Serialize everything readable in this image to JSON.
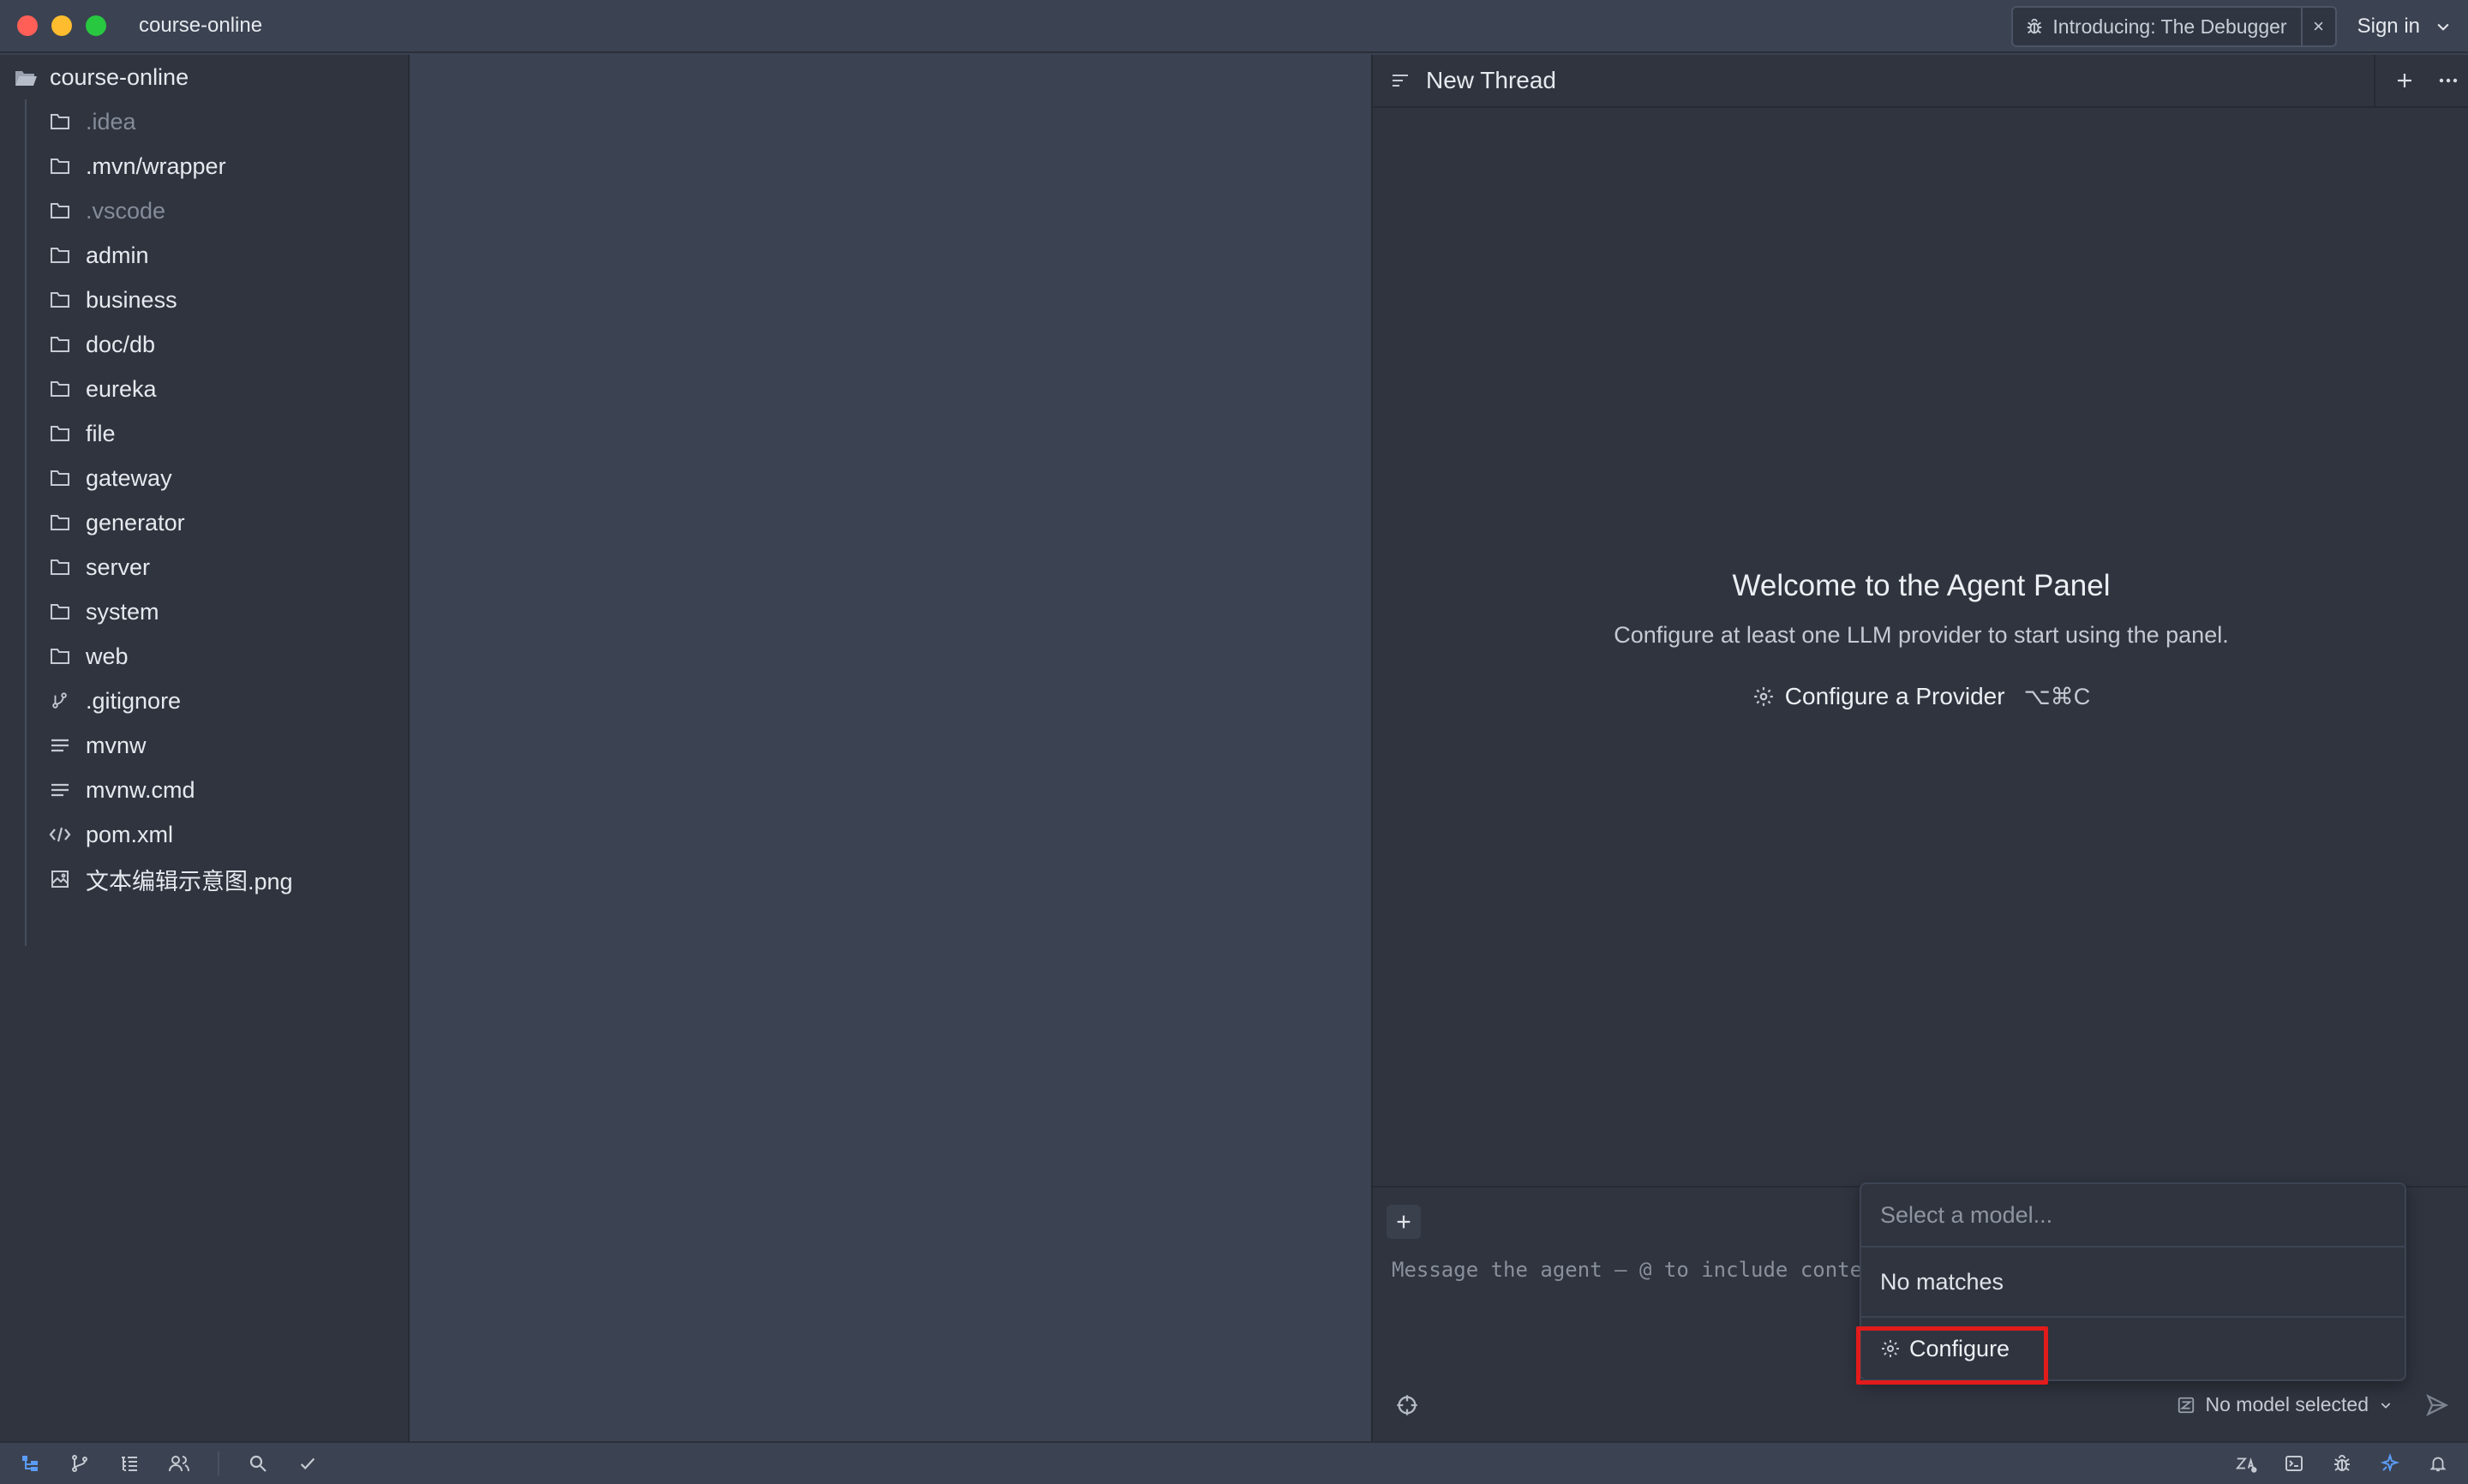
{
  "window": {
    "title": "course-online",
    "announcement": "Introducing: The Debugger",
    "announcement_close": "×",
    "sign_in": "Sign in"
  },
  "project": {
    "root": "course-online",
    "items": [
      {
        "label": ".idea",
        "icon": "folder-icon",
        "dim": true
      },
      {
        "label": ".mvn/wrapper",
        "icon": "folder-icon",
        "dim": false
      },
      {
        "label": ".vscode",
        "icon": "folder-icon",
        "dim": true
      },
      {
        "label": "admin",
        "icon": "folder-icon",
        "dim": false
      },
      {
        "label": "business",
        "icon": "folder-icon",
        "dim": false
      },
      {
        "label": "doc/db",
        "icon": "folder-icon",
        "dim": false
      },
      {
        "label": "eureka",
        "icon": "folder-icon",
        "dim": false
      },
      {
        "label": "file",
        "icon": "folder-icon",
        "dim": false
      },
      {
        "label": "gateway",
        "icon": "folder-icon",
        "dim": false
      },
      {
        "label": "generator",
        "icon": "folder-icon",
        "dim": false
      },
      {
        "label": "server",
        "icon": "folder-icon",
        "dim": false
      },
      {
        "label": "system",
        "icon": "folder-icon",
        "dim": false
      },
      {
        "label": "web",
        "icon": "folder-icon",
        "dim": false
      },
      {
        "label": ".gitignore",
        "icon": "git-icon",
        "dim": false
      },
      {
        "label": "mvnw",
        "icon": "text-file-icon",
        "dim": false
      },
      {
        "label": "mvnw.cmd",
        "icon": "text-file-icon",
        "dim": false
      },
      {
        "label": "pom.xml",
        "icon": "code-file-icon",
        "dim": false
      },
      {
        "label": "文本编辑示意图.png",
        "icon": "image-file-icon",
        "dim": false
      }
    ]
  },
  "agent": {
    "thread_title": "New Thread",
    "welcome_title": "Welcome to the Agent Panel",
    "welcome_text": "Configure at least one LLM provider to start using the panel.",
    "configure_provider": "Configure a Provider",
    "configure_shortcut": "⌥⌘C",
    "message_placeholder": "Message the agent – @ to include context",
    "model_selected": "No model selected"
  },
  "model_dropdown": {
    "placeholder": "Select a model...",
    "empty": "No matches",
    "configure": "Configure"
  },
  "colors": {
    "accent": "#5b9cf5",
    "highlight": "#e21b1b"
  }
}
